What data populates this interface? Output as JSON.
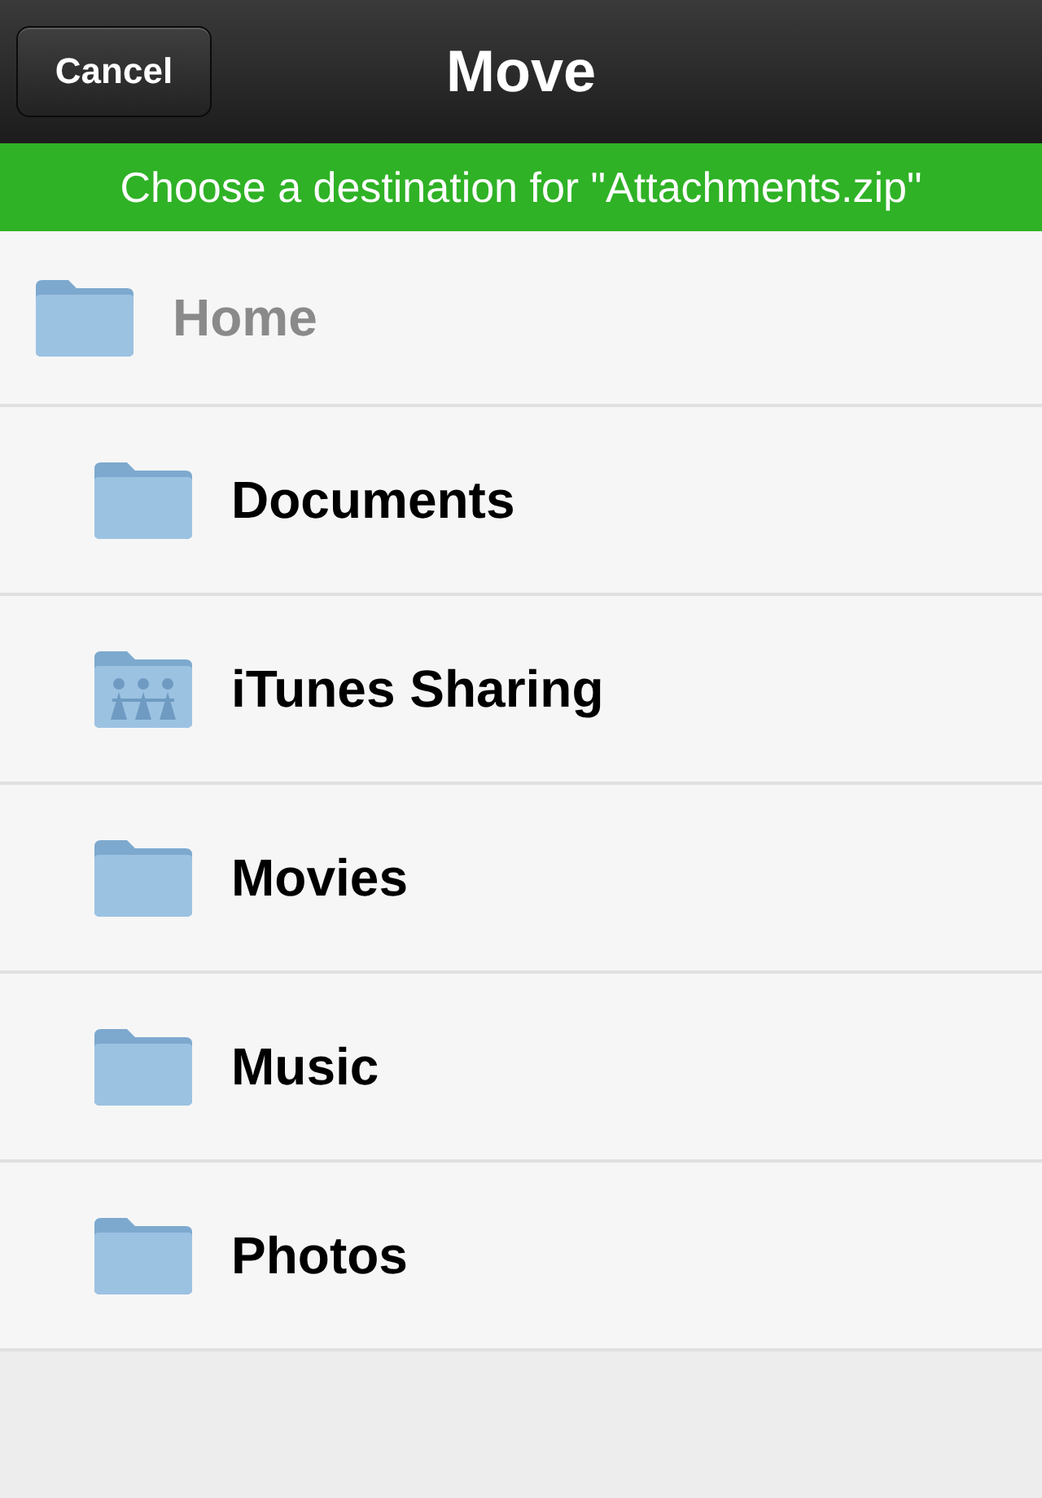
{
  "nav_bar": {
    "cancel_button": "Cancel",
    "title": "Move"
  },
  "banner": "Choose a destination for \"Attachments.zip\"",
  "tree": {
    "label": "Home",
    "children": [
      {
        "label": "Documents",
        "kind": "folder"
      },
      {
        "label": "iTunes Sharing",
        "kind": "shared"
      },
      {
        "label": "Movies",
        "kind": "folder"
      },
      {
        "label": "Music",
        "kind": "folder"
      },
      {
        "label": "Photos",
        "kind": "folder"
      }
    ]
  }
}
